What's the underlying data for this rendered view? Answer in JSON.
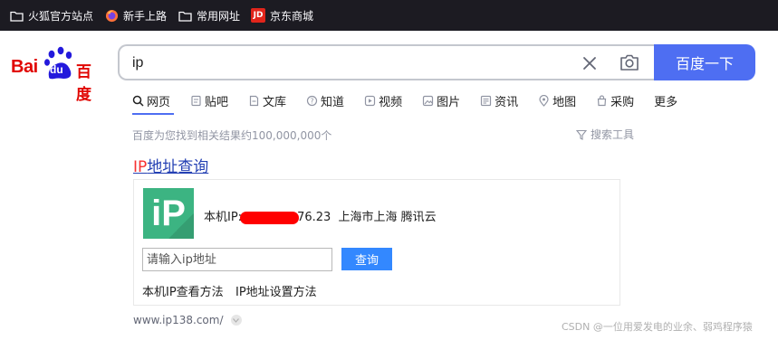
{
  "bookmarks": [
    {
      "label": "火狐官方站点",
      "icon": "folder-icon"
    },
    {
      "label": "新手上路",
      "icon": "firefox-icon"
    },
    {
      "label": "常用网址",
      "icon": "folder-icon"
    },
    {
      "label": "京东商城",
      "icon": "jd-icon",
      "icon_text": "JD"
    }
  ],
  "logo": {
    "left": "Bai",
    "paw": "du",
    "right": "百度"
  },
  "search": {
    "value": "ip",
    "button_label": "百度一下"
  },
  "tabs": [
    {
      "label": "网页",
      "icon": "search-icon"
    },
    {
      "label": "贴吧",
      "icon": "tieba-icon"
    },
    {
      "label": "文库",
      "icon": "document-icon"
    },
    {
      "label": "知道",
      "icon": "question-icon"
    },
    {
      "label": "视频",
      "icon": "video-icon"
    },
    {
      "label": "图片",
      "icon": "image-icon"
    },
    {
      "label": "资讯",
      "icon": "news-icon"
    },
    {
      "label": "地图",
      "icon": "map-icon"
    },
    {
      "label": "采购",
      "icon": "purchase-icon"
    },
    {
      "label": "更多",
      "icon": ""
    }
  ],
  "result_count": "百度为您找到相关结果约100,000,000个",
  "search_tools": "搜索工具",
  "result": {
    "title_highlight": "IP",
    "title_rest": "地址查询",
    "logo_text": "iP",
    "ip_label": "本机IP:",
    "ip_suffix": "76.23",
    "location": "上海市上海 腾讯云",
    "input_placeholder": "请输入ip地址",
    "query_button": "查询",
    "link_1": "本机IP查看方法",
    "link_2": "IP地址设置方法",
    "url": "www.ip138.com/"
  },
  "watermark": "CSDN @一位用爱发电的业余、弱鸡程序猿",
  "colors": {
    "brand_blue": "#4e6ef2",
    "brand_red": "#e10602",
    "link": "#2440b3",
    "highlight": "#f73131",
    "ip_green": "#3cb482",
    "query_blue": "#3388ff"
  }
}
